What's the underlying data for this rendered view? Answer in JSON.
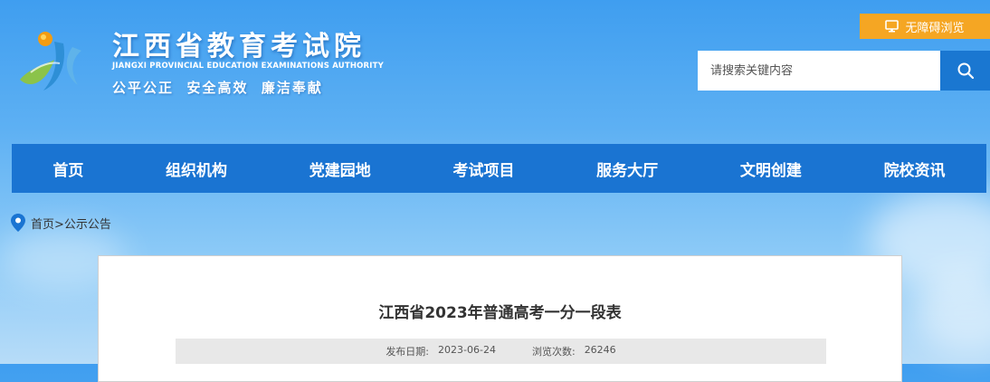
{
  "header": {
    "site_title": "江西省教育考试院",
    "site_subtitle": "JIANGXI PROVINCIAL EDUCATION EXAMINATIONS AUTHORITY",
    "motto": "公平公正  安全高效  廉洁奉献",
    "logo_icon": "jx-logo-icon"
  },
  "accessibility": {
    "label": "无障碍浏览",
    "icon": "monitor-icon"
  },
  "search": {
    "placeholder": "请搜索关键内容",
    "value": "",
    "icon": "search-icon"
  },
  "nav": {
    "items": [
      {
        "label": "首页"
      },
      {
        "label": "组织机构"
      },
      {
        "label": "党建园地"
      },
      {
        "label": "考试项目"
      },
      {
        "label": "服务大厅"
      },
      {
        "label": "文明创建"
      },
      {
        "label": "院校资讯"
      }
    ]
  },
  "breadcrumb": {
    "icon": "location-pin-icon",
    "home": "首页",
    "separator": ">",
    "current": "公示公告"
  },
  "article": {
    "title": "江西省2023年普通高考一分一段表",
    "publish_label": "发布日期:",
    "publish_date": "2023-06-24",
    "views_label": "浏览次数:",
    "views": "26246"
  },
  "colors": {
    "nav": "#1a74d2",
    "accent": "#f5a623",
    "search_button": "#1a77d1"
  }
}
